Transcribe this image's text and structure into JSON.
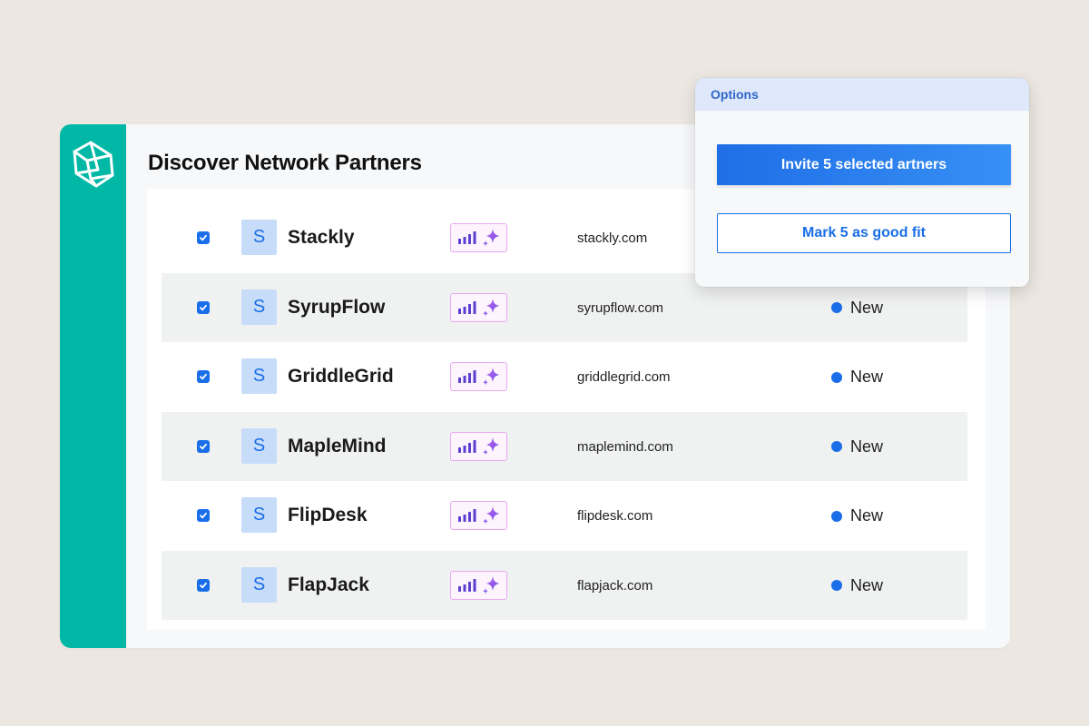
{
  "page": {
    "title": "Discover Network Partners"
  },
  "options_panel": {
    "header": "Options",
    "invite_label": "Invite 5 selected artners",
    "good_fit_label": "Mark 5 as good fit"
  },
  "colors": {
    "rail": "#00b8a5",
    "accent": "#1a6ee8",
    "badge_border": "#e9a8f2",
    "row_alt": "#f0f1f1"
  },
  "partners": [
    {
      "checked": true,
      "avatar": "S",
      "name": "Stackly",
      "domain": "stackly.com",
      "status": "",
      "fit_icon": "signal-sparkle-icon"
    },
    {
      "checked": true,
      "avatar": "S",
      "name": "SyrupFlow",
      "domain": "syrupflow.com",
      "status": "New",
      "fit_icon": "signal-sparkle-icon"
    },
    {
      "checked": true,
      "avatar": "S",
      "name": "GriddleGrid",
      "domain": "griddlegrid.com",
      "status": "New",
      "fit_icon": "signal-sparkle-icon"
    },
    {
      "checked": true,
      "avatar": "S",
      "name": "MapleMind",
      "domain": "maplemind.com",
      "status": "New",
      "fit_icon": "signal-sparkle-icon"
    },
    {
      "checked": true,
      "avatar": "S",
      "name": "FlipDesk",
      "domain": "flipdesk.com",
      "status": "New",
      "fit_icon": "signal-sparkle-icon"
    },
    {
      "checked": true,
      "avatar": "S",
      "name": "FlapJack",
      "domain": "flapjack.com",
      "status": "New",
      "fit_icon": "signal-sparkle-icon"
    }
  ]
}
